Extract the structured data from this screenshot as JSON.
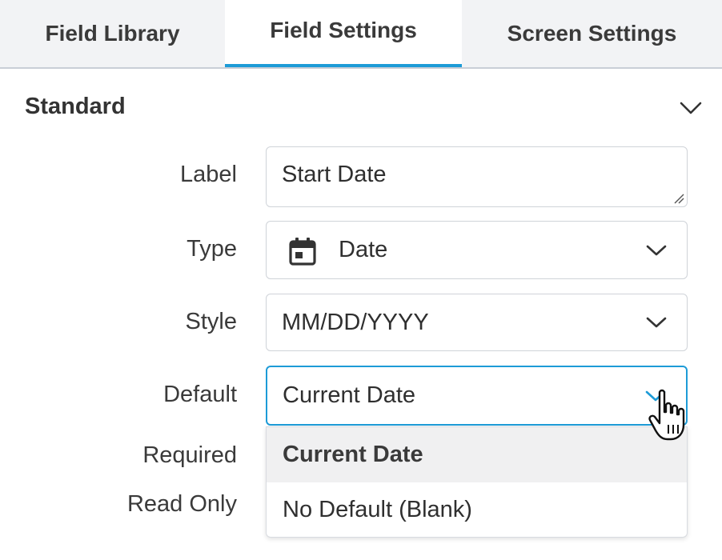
{
  "tabs": [
    {
      "label": "Field Library"
    },
    {
      "label": "Field Settings"
    },
    {
      "label": "Screen Settings"
    }
  ],
  "section": {
    "title": "Standard",
    "icon": "chevron-down-icon"
  },
  "form": {
    "label": {
      "label": "Label",
      "value": "Start Date"
    },
    "type": {
      "label": "Type",
      "value": "Date",
      "icon": "calendar-icon"
    },
    "style": {
      "label": "Style",
      "value": "MM/DD/YYYY"
    },
    "default": {
      "label": "Default",
      "value": "Current Date"
    },
    "required": {
      "label": "Required"
    },
    "read_only": {
      "label": "Read Only"
    }
  },
  "default_options": [
    {
      "label": "Current Date",
      "selected": true
    },
    {
      "label": "No Default (Blank)",
      "selected": false
    }
  ],
  "colors": {
    "accent": "#1d9bd7",
    "border": "#cfd3d8",
    "tab_bg": "#f2f3f5"
  }
}
